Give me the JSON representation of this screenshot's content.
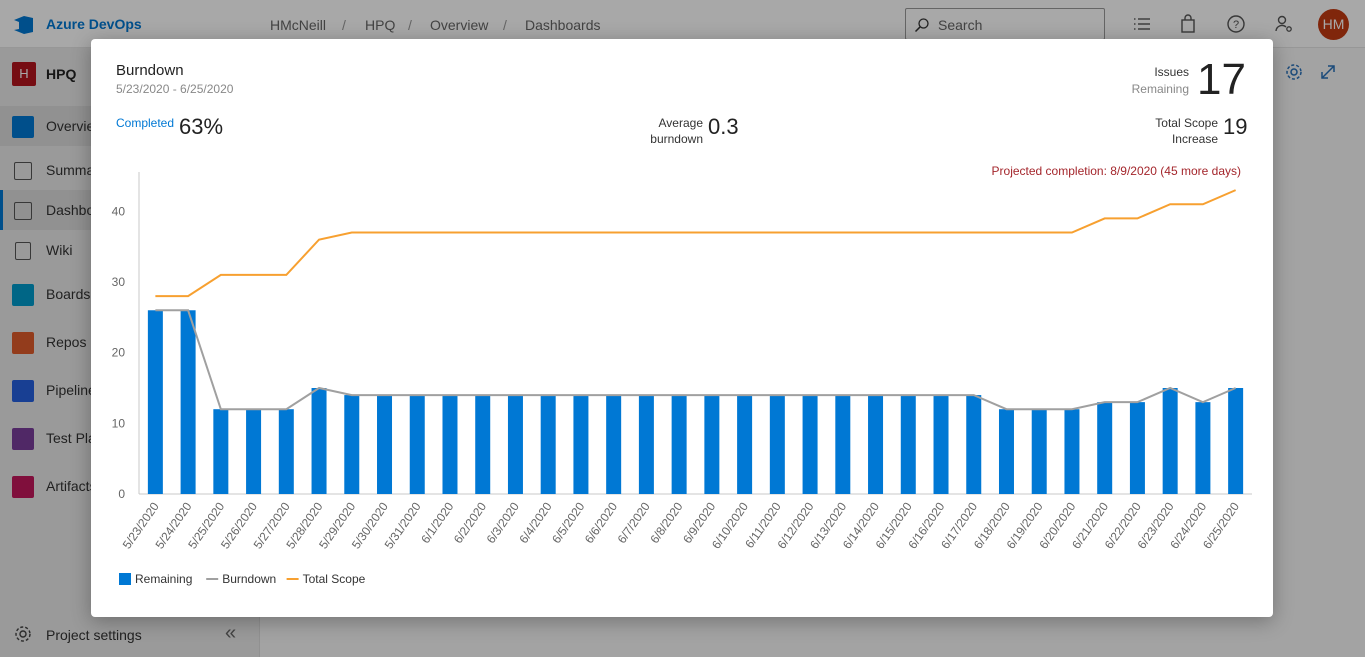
{
  "topbar": {
    "brand": "Azure DevOps",
    "breadcrumbs": [
      "HMcNeill",
      "HPQ",
      "Overview",
      "Dashboards"
    ],
    "search_placeholder": "Search",
    "avatar_initials": "HM"
  },
  "leftnav": {
    "project_initial": "H",
    "project_name": "HPQ",
    "items": [
      {
        "label": "Overview",
        "icon": "overview-icon",
        "color": "#0078d4"
      },
      {
        "label": "Summary",
        "icon": "summary-icon",
        "color": "#666666"
      },
      {
        "label": "Dashboards",
        "icon": "dashboards-icon",
        "color": "#666666"
      },
      {
        "label": "Wiki",
        "icon": "wiki-icon",
        "color": "#666666"
      },
      {
        "label": "Boards",
        "icon": "boards-icon",
        "color": "#009ccc"
      },
      {
        "label": "Repos",
        "icon": "repos-icon",
        "color": "#e05b2b"
      },
      {
        "label": "Pipelines",
        "icon": "pipelines-icon",
        "color": "#2560e0"
      },
      {
        "label": "Test Plans",
        "icon": "test-plans-icon",
        "color": "#7a3d9c"
      },
      {
        "label": "Artifacts",
        "icon": "artifacts-icon",
        "color": "#c2185b"
      }
    ],
    "settings_label": "Project settings"
  },
  "modal": {
    "title": "Burndown",
    "date_range": "5/23/2020 - 6/25/2020",
    "completed_label": "Completed",
    "completed_value": "63%",
    "avg_label_line1": "Average",
    "avg_label_line2": "burndown",
    "avg_value": "0.3",
    "issues_label": "Issues",
    "remaining_label": "Remaining",
    "issues_value": "17",
    "scope_label_line1": "Total Scope",
    "scope_label_line2": "Increase",
    "scope_value": "19",
    "projected": "Projected completion: 8/9/2020 (45 more days)"
  },
  "chart_data": {
    "type": "bar",
    "categories": [
      "5/23/2020",
      "5/24/2020",
      "5/25/2020",
      "5/26/2020",
      "5/27/2020",
      "5/28/2020",
      "5/29/2020",
      "5/30/2020",
      "5/31/2020",
      "6/1/2020",
      "6/2/2020",
      "6/3/2020",
      "6/4/2020",
      "6/5/2020",
      "6/6/2020",
      "6/7/2020",
      "6/8/2020",
      "6/9/2020",
      "6/10/2020",
      "6/11/2020",
      "6/12/2020",
      "6/13/2020",
      "6/14/2020",
      "6/15/2020",
      "6/16/2020",
      "6/17/2020",
      "6/18/2020",
      "6/19/2020",
      "6/20/2020",
      "6/21/2020",
      "6/22/2020",
      "6/23/2020",
      "6/24/2020",
      "6/25/2020"
    ],
    "series": [
      {
        "name": "Remaining",
        "kind": "bar",
        "color": "#0078d4",
        "values": [
          26,
          26,
          12,
          12,
          12,
          15,
          14,
          14,
          14,
          14,
          14,
          14,
          14,
          14,
          14,
          14,
          14,
          14,
          14,
          14,
          14,
          14,
          14,
          14,
          14,
          14,
          12,
          12,
          12,
          13,
          13,
          15,
          13,
          15
        ]
      },
      {
        "name": "Burndown",
        "kind": "line",
        "color": "#a0a0a0",
        "values": [
          26,
          26,
          12,
          12,
          12,
          15,
          14,
          14,
          14,
          14,
          14,
          14,
          14,
          14,
          14,
          14,
          14,
          14,
          14,
          14,
          14,
          14,
          14,
          14,
          14,
          14,
          12,
          12,
          12,
          13,
          13,
          15,
          13,
          15
        ]
      },
      {
        "name": "Total Scope",
        "kind": "line",
        "color": "#f7a030",
        "values": [
          28,
          28,
          31,
          31,
          31,
          36,
          37,
          37,
          37,
          37,
          37,
          37,
          37,
          37,
          37,
          37,
          37,
          37,
          37,
          37,
          37,
          37,
          37,
          37,
          37,
          37,
          37,
          37,
          37,
          39,
          39,
          41,
          41,
          43
        ]
      }
    ],
    "yticks": [
      0,
      10,
      20,
      30,
      40
    ],
    "ylim": [
      0,
      45
    ],
    "legend": "bottom-left"
  }
}
